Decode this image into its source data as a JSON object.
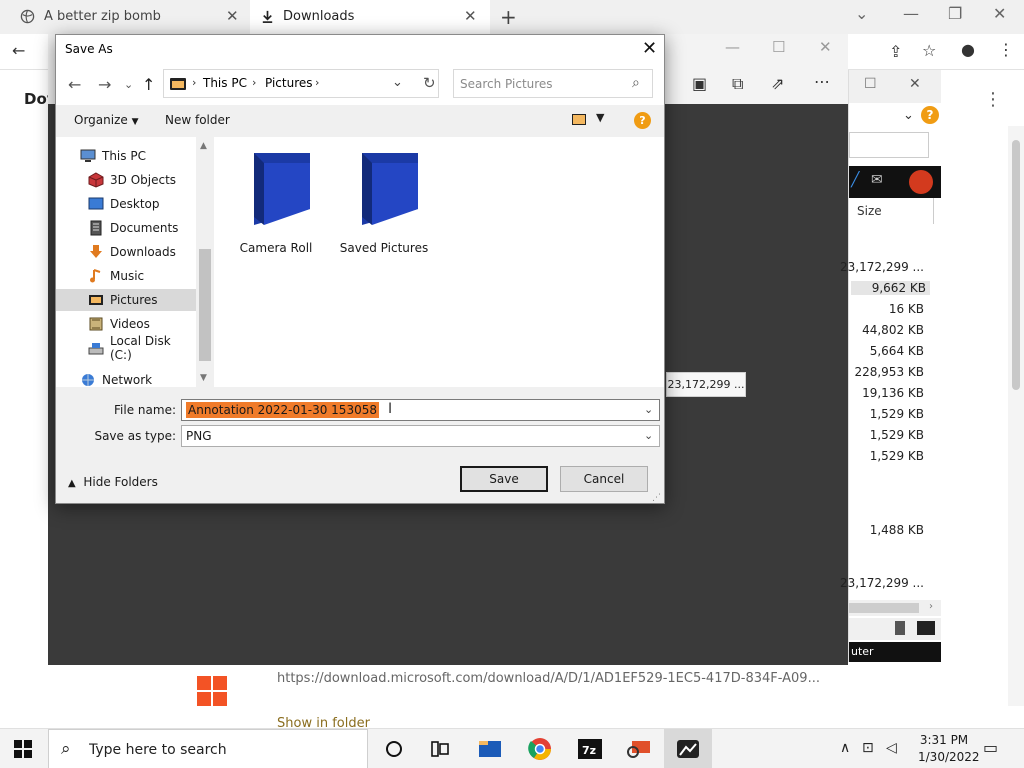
{
  "browser": {
    "tabs": [
      {
        "label": "A better zip bomb"
      },
      {
        "label": "Downloads"
      }
    ],
    "page_title": "Dov",
    "download": {
      "url": "https://download.microsoft.com/download/A/D/1/AD1EF529-1EC5-417D-834F-A09...",
      "show_in_folder": "Show in folder"
    }
  },
  "right_panel": {
    "size_header": "Size",
    "sizes": [
      "23,172,299 ...",
      "9,662 KB",
      "16 KB",
      "44,802 KB",
      "5,664 KB",
      "228,953 KB",
      "19,136 KB",
      "1,529 KB",
      "1,529 KB",
      "1,529 KB",
      "1,488 KB",
      "23,172,299 ..."
    ],
    "status_text": "uter"
  },
  "tooltip": {
    "text": "23,172,299 ..."
  },
  "dialog": {
    "title": "Save As",
    "breadcrumb": [
      "This PC",
      "Pictures"
    ],
    "search_placeholder": "Search Pictures",
    "organize_label": "Organize",
    "new_folder_label": "New folder",
    "nav_items": [
      {
        "label": "This PC",
        "icon": "pc-icon"
      },
      {
        "label": "3D Objects",
        "icon": "3d-objects-icon"
      },
      {
        "label": "Desktop",
        "icon": "desktop-icon"
      },
      {
        "label": "Documents",
        "icon": "documents-icon"
      },
      {
        "label": "Downloads",
        "icon": "downloads-icon"
      },
      {
        "label": "Music",
        "icon": "music-icon"
      },
      {
        "label": "Pictures",
        "icon": "pictures-icon",
        "selected": true
      },
      {
        "label": "Videos",
        "icon": "videos-icon"
      },
      {
        "label": "Local Disk (C:)",
        "icon": "disk-icon"
      },
      {
        "label": "Network",
        "icon": "network-icon"
      }
    ],
    "folders": [
      {
        "label": "Camera Roll"
      },
      {
        "label": "Saved Pictures"
      }
    ],
    "file_name_label": "File name:",
    "file_name_value": "Annotation 2022-01-30 153058",
    "save_type_label": "Save as type:",
    "save_type_value": "PNG",
    "hide_folders_label": "Hide Folders",
    "save_label": "Save",
    "cancel_label": "Cancel"
  },
  "taskbar": {
    "search_placeholder": "Type here to search",
    "time": "3:31 PM",
    "date": "1/30/2022"
  },
  "colors": {
    "selection": "#f07b2a",
    "folder_blue": "#1b3aa6",
    "help_orange": "#f09c13",
    "ms_red": "#f35325"
  }
}
